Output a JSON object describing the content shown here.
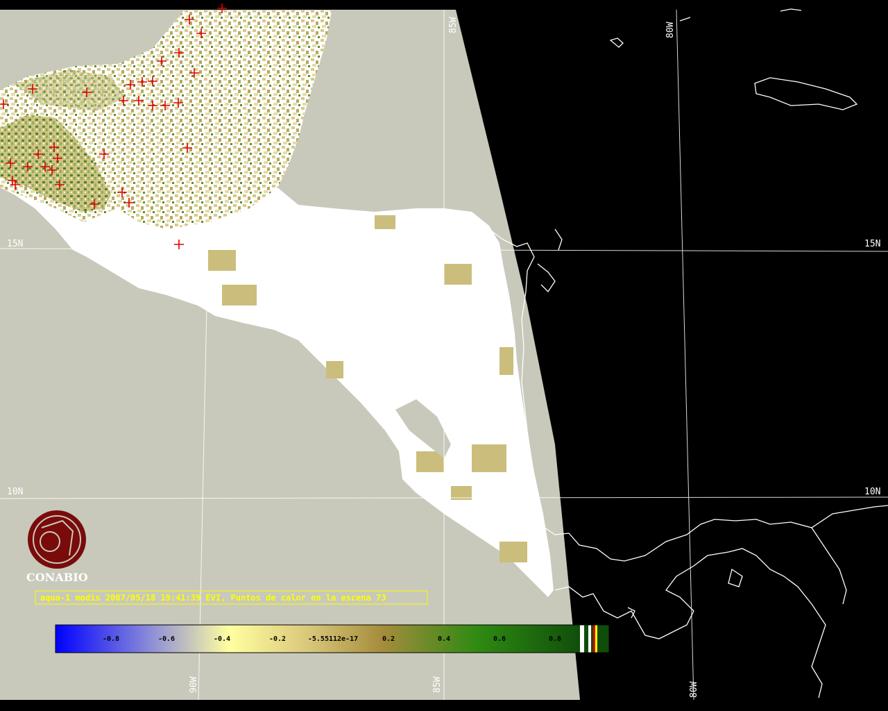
{
  "colors": {
    "background": "#000000",
    "swath": "#c8c9bb",
    "land_cloud": "#ffffff",
    "coastline": "#ffffff",
    "fire": "#e00000",
    "caption": "#ffff00",
    "brand": "#7a0b0b"
  },
  "map": {
    "lat_labels": [
      "15N",
      "10N"
    ],
    "lon_labels": [
      "85W",
      "80W",
      "90W"
    ],
    "fire_marker_icon": "plus-icon"
  },
  "logo": {
    "icon": "conabio-logo-icon",
    "text": "CONABIO"
  },
  "caption": {
    "text": "aqua-1 modis 2007/05/18 19:41:39 EVI, Puntos de calor en la escena 73"
  },
  "colorbar": {
    "ticks": [
      "-0.8",
      "-0.6",
      "-0.4",
      "-0.2",
      "-5.55112e-17",
      "0.2",
      "0.4",
      "0.6",
      "0.8"
    ],
    "gradient_stops": [
      "#0000ff",
      "#8c8cd8",
      "#ffffa0",
      "#d9c77a",
      "#a58c3c",
      "#2f8a12",
      "#0f4d0a"
    ]
  }
}
